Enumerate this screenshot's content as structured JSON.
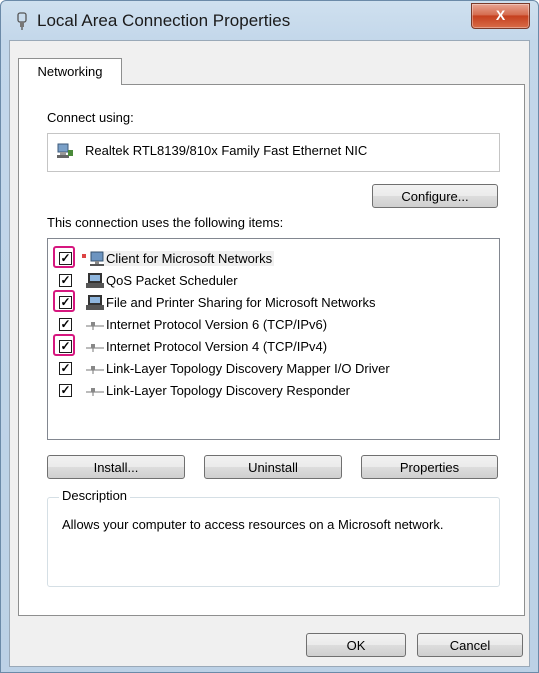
{
  "window": {
    "title": "Local Area Connection Properties",
    "close_label": "X"
  },
  "tabs": [
    {
      "label": "Networking",
      "selected": true
    }
  ],
  "connect_using": {
    "label": "Connect using:",
    "adapter": "Realtek RTL8139/810x Family Fast Ethernet NIC",
    "configure_label": "Configure..."
  },
  "items_section": {
    "label": "This connection uses the following items:",
    "items": [
      {
        "label": "Client for Microsoft Networks",
        "checked": true,
        "highlighted": true,
        "selected": true,
        "icon": "network-client-icon"
      },
      {
        "label": "QoS Packet Scheduler",
        "checked": true,
        "highlighted": false,
        "selected": false,
        "icon": "service-icon"
      },
      {
        "label": "File and Printer Sharing for Microsoft Networks",
        "checked": true,
        "highlighted": true,
        "selected": false,
        "icon": "service-icon"
      },
      {
        "label": "Internet Protocol Version 6 (TCP/IPv6)",
        "checked": true,
        "highlighted": false,
        "selected": false,
        "icon": "protocol-icon"
      },
      {
        "label": "Internet Protocol Version 4 (TCP/IPv4)",
        "checked": true,
        "highlighted": true,
        "selected": false,
        "icon": "protocol-icon"
      },
      {
        "label": "Link-Layer Topology Discovery Mapper I/O Driver",
        "checked": true,
        "highlighted": false,
        "selected": false,
        "icon": "protocol-icon"
      },
      {
        "label": "Link-Layer Topology Discovery Responder",
        "checked": true,
        "highlighted": false,
        "selected": false,
        "icon": "protocol-icon"
      }
    ]
  },
  "buttons": {
    "install": "Install...",
    "uninstall": "Uninstall",
    "properties": "Properties",
    "ok": "OK",
    "cancel": "Cancel"
  },
  "description": {
    "legend": "Description",
    "text": "Allows your computer to access resources on a Microsoft network."
  },
  "colors": {
    "highlight_border": "#d6177f",
    "titlebar": "#c3d7ea",
    "close_button": "#c5401f"
  }
}
